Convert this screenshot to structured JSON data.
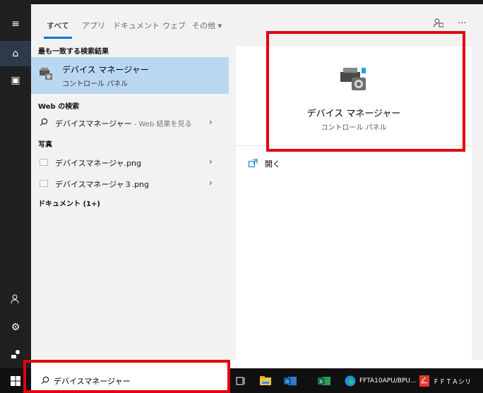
{
  "tabs": [
    "すべて",
    "アプリ",
    "ドキュメント",
    "ウェブ",
    "その他 ▾"
  ],
  "sections": {
    "best_match": "最も一致する検索結果",
    "web": "Web の検索",
    "photos": "写真",
    "documents": "ドキュメント (1+)"
  },
  "best": {
    "title": "デバイス マネージャー",
    "subtitle": "コントロール パネル"
  },
  "web_item": {
    "text": "デバイスマネージャー",
    "suffix": " - Web 結果を見る"
  },
  "photos": [
    {
      "name": "デバイスマネージャ.png"
    },
    {
      "name": "デバイスマネージャ３.png"
    }
  ],
  "detail": {
    "title": "デバイス マネージャー",
    "subtitle": "コントロール パネル",
    "open_label": "開く"
  },
  "search": {
    "value": "デバイスマネージャー"
  },
  "taskbar": {
    "app1": "FFTA10APU/BPU...",
    "app2": "ＦＦＴＡシリ"
  },
  "colors": {
    "accent": "#0078d7",
    "highlight": "#b9d7f1",
    "annotation": "#e3000f"
  }
}
